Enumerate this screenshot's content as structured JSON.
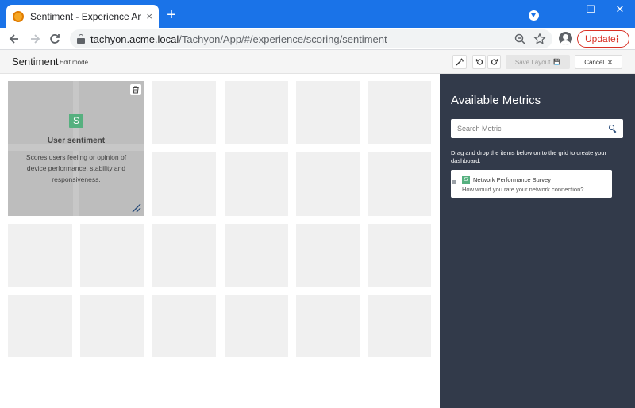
{
  "browser": {
    "tab_title": "Sentiment - Experience Analytics",
    "tab_close": "×",
    "new_tab": "+",
    "minimize": "—",
    "maximize": "☐",
    "close": "✕",
    "url_host": "tachyon.acme.local",
    "url_path": "/Tachyon/App/#/experience/scoring/sentiment",
    "update_label": "Update",
    "update_menu": "⋮"
  },
  "header": {
    "title": "Sentiment",
    "mode": "Edit mode",
    "save_layout": "Save Layout",
    "save_icon": "💾",
    "cancel": "Cancel",
    "cancel_icon": "✕"
  },
  "tile": {
    "badge": "S",
    "title": "User sentiment",
    "description": "Scores users feeling or opinion of device performance, stability and responsiveness."
  },
  "panel": {
    "title": "Available Metrics",
    "search_placeholder": "Search Metric",
    "hint": "Drag and drop the items below on to the grid to create your dashboard.",
    "metrics": [
      {
        "badge": "S",
        "name": "Network Performance Survey",
        "question": "How would you rate your network connection?"
      }
    ]
  },
  "colors": {
    "chrome_blue": "#1a73e8",
    "panel_bg": "#323a4a",
    "badge_green": "#56b07f",
    "update_red": "#d93025"
  }
}
